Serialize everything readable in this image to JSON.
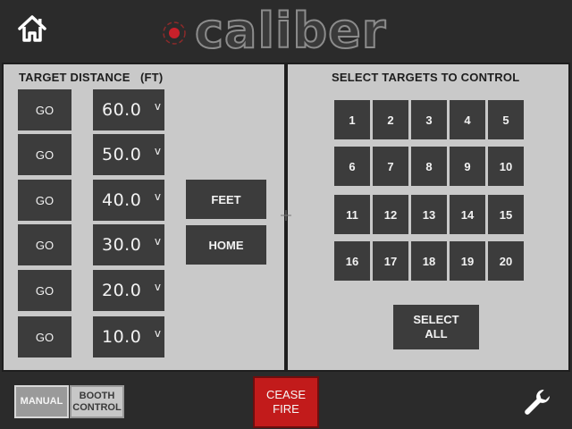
{
  "header": {
    "logo_text": "caliber"
  },
  "distance_panel": {
    "title": "TARGET DISTANCE   (FT)",
    "rows": [
      {
        "go_label": "GO",
        "distance": "60.0",
        "chevron": "v"
      },
      {
        "go_label": "GO",
        "distance": "50.0",
        "chevron": "v"
      },
      {
        "go_label": "GO",
        "distance": "40.0",
        "chevron": "v"
      },
      {
        "go_label": "GO",
        "distance": "30.0",
        "chevron": "v"
      },
      {
        "go_label": "GO",
        "distance": "20.0",
        "chevron": "v"
      },
      {
        "go_label": "GO",
        "distance": "10.0",
        "chevron": "v"
      }
    ],
    "feet_label": "FEET",
    "home_label": "HOME"
  },
  "target_panel": {
    "title": "SELECT TARGETS TO CONTROL",
    "targets": [
      "1",
      "2",
      "3",
      "4",
      "5",
      "6",
      "7",
      "8",
      "9",
      "10",
      "11",
      "12",
      "13",
      "14",
      "15",
      "16",
      "17",
      "18",
      "19",
      "20"
    ],
    "select_all_label": "SELECT\nALL"
  },
  "footer": {
    "manual_label": "MANUAL",
    "booth_label": "BOOTH\nCONTROL",
    "cease_fire_label": "CEASE\nFIRE"
  },
  "colors": {
    "panel_bg": "#c9c9c9",
    "button_bg": "#3c3c3c",
    "cease_fire": "#c21b1b",
    "logo_dot": "#c8202a"
  },
  "icons": {
    "home": "home-icon",
    "settings": "wrench-icon",
    "logo": "caliber-target-icon"
  }
}
